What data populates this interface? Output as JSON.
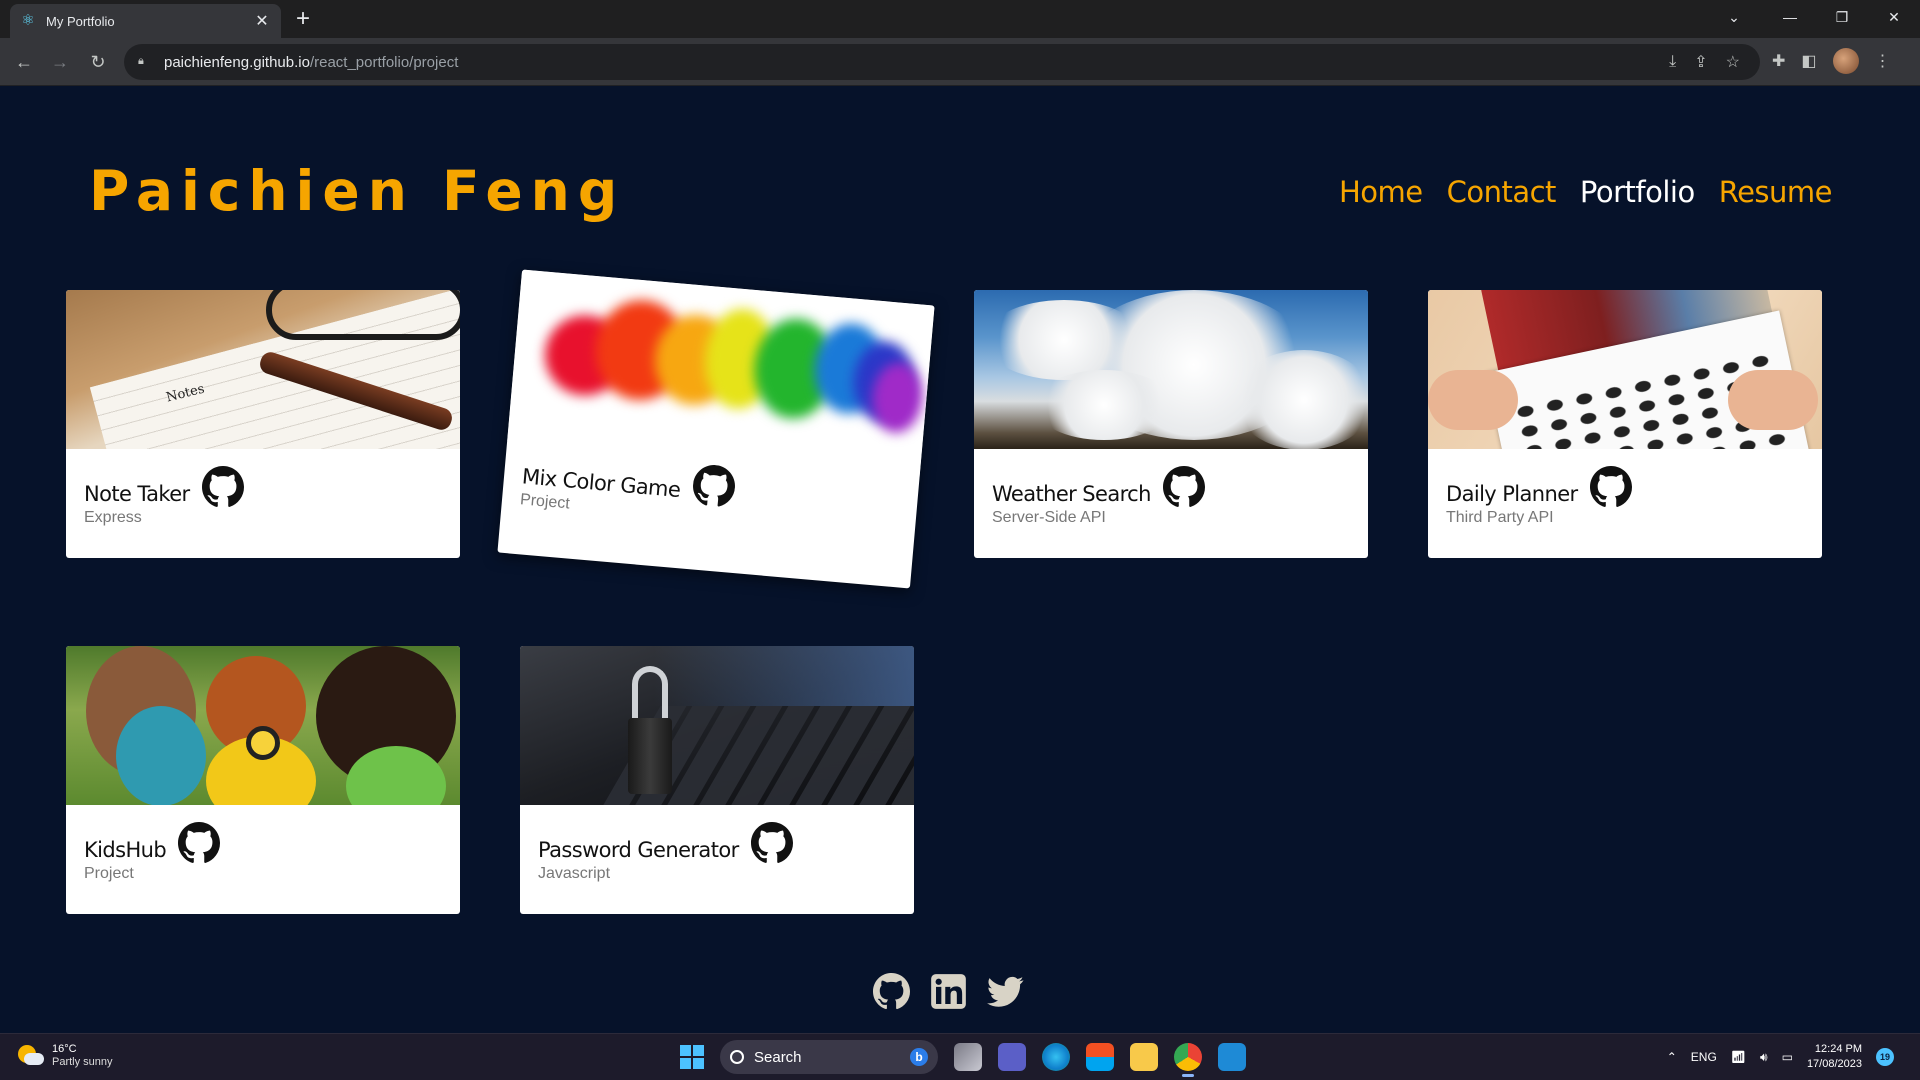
{
  "browser": {
    "tab_title": "My Portfolio",
    "url_host": "paichienfeng.github.io",
    "url_path": "/react_portfolio/project"
  },
  "site": {
    "brand": "Paichien Feng",
    "nav": [
      "Home",
      "Contact",
      "Portfolio",
      "Resume"
    ],
    "active_nav": "Portfolio",
    "accent_color": "#f6a500",
    "background_color": "#06122a"
  },
  "projects": [
    {
      "title": "Note Taker",
      "subtitle": "Express"
    },
    {
      "title": "Mix Color Game",
      "subtitle": "Project"
    },
    {
      "title": "Weather Search",
      "subtitle": "Server-Side API"
    },
    {
      "title": "Daily Planner",
      "subtitle": "Third Party API"
    },
    {
      "title": "KidsHub",
      "subtitle": "Project"
    },
    {
      "title": "Password Generator",
      "subtitle": "Javascript"
    }
  ],
  "footer": {
    "social_icons": [
      "github-icon",
      "linkedin-icon",
      "twitter-icon"
    ]
  },
  "taskbar": {
    "weather_temp": "16°C",
    "weather_cond": "Partly sunny",
    "search_label": "Search",
    "language": "ENG",
    "time": "12:24 PM",
    "date": "17/08/2023",
    "notification_count": "19"
  }
}
